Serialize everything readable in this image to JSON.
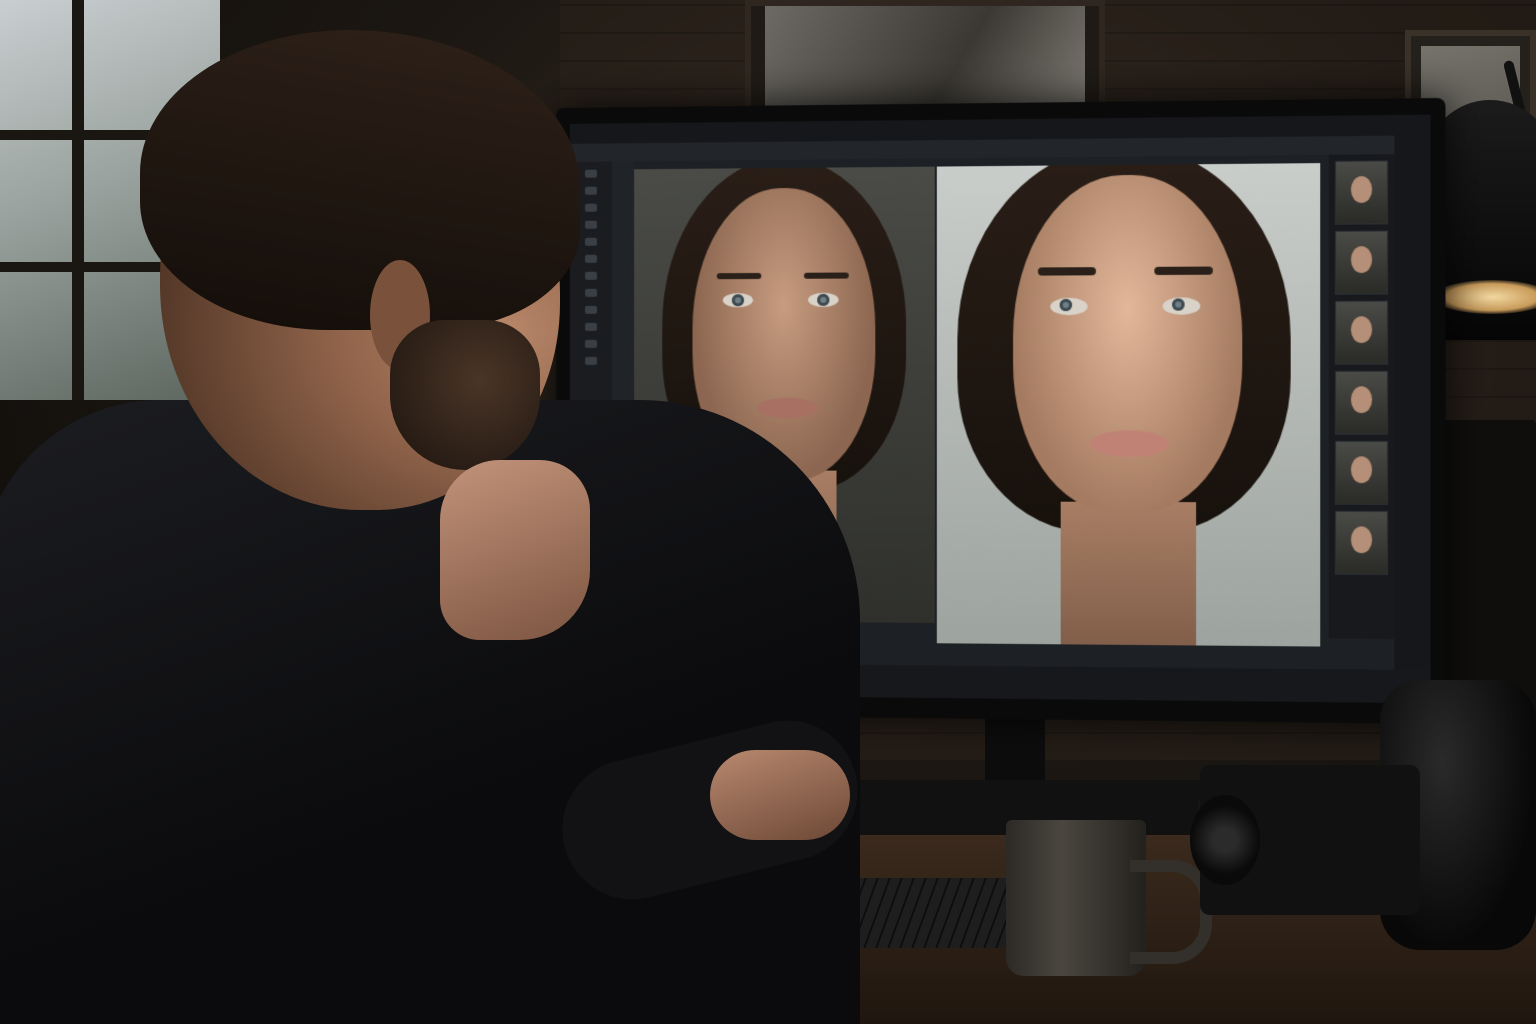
{
  "scene": {
    "description_tags": [
      "man",
      "monitor",
      "photo-editing-app",
      "portrait",
      "desk"
    ],
    "colors": {
      "ambient": "#1c1712",
      "screen_bg": "#1d2024",
      "lamp_glow": "#f3d9a2"
    }
  },
  "app": {
    "menu_items": [
      "",
      "",
      "",
      "",
      "",
      "",
      "",
      "",
      ""
    ],
    "toolbar_items": [
      "",
      "",
      "",
      "",
      "",
      ""
    ],
    "status_items": [
      "",
      "",
      "",
      ""
    ],
    "filmstrip": {
      "thumbnails": [
        {
          "label": ""
        },
        {
          "label": ""
        },
        {
          "label": ""
        },
        {
          "label": ""
        },
        {
          "label": ""
        },
        {
          "label": ""
        },
        {
          "label": ""
        }
      ]
    },
    "icons": {
      "tool": "tool-icon",
      "thumbnail": "thumbnail-icon"
    }
  }
}
